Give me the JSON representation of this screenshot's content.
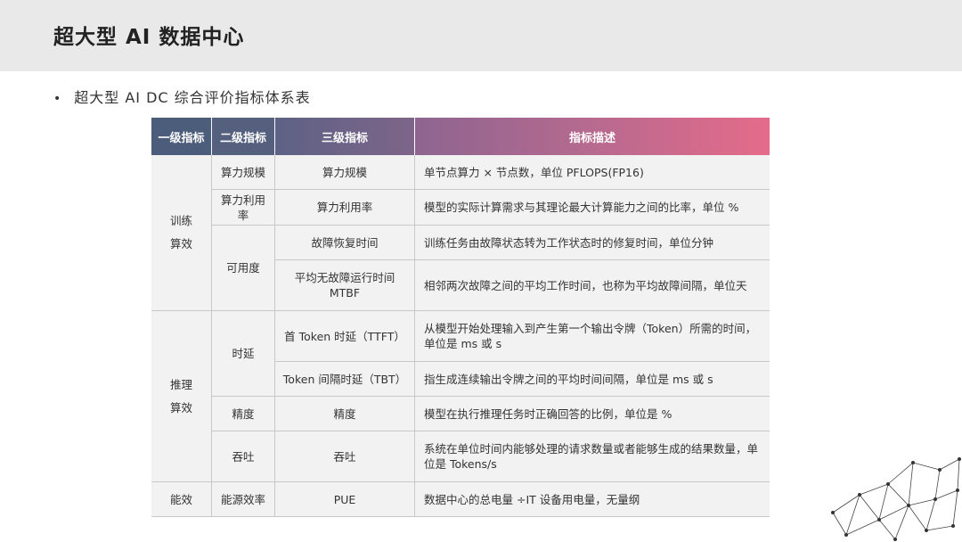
{
  "slide": {
    "title": "超大型 AI 数据中心",
    "bullet": "超大型 AI DC 综合评价指标体系表"
  },
  "table": {
    "headers": [
      "一级指标",
      "二级指标",
      "三级指标",
      "指标描述"
    ],
    "level1": [
      "训练\n算效",
      "推理\n算效",
      "能效"
    ],
    "level2": [
      "算力规模",
      "算力利用率",
      "可用度",
      "时延",
      "精度",
      "吞吐",
      "能源效率"
    ],
    "level3": [
      "算力规模",
      "算力利用率",
      "故障恢复时间",
      "平均无故障运行时间\nMTBF",
      "首 Token 时延（TTFT）",
      "Token 间隔时延（TBT）",
      "精度",
      "吞吐",
      "PUE"
    ],
    "descriptions": [
      "单节点算力 × 节点数，单位 PFLOPS(FP16)",
      "模型的实际计算需求与其理论最大计算能力之间的比率，单位 %",
      "训练任务由故障状态转为工作状态时的修复时间，单位分钟",
      "相邻两次故障之间的平均工作时间，也称为平均故障间隔，单位天",
      "从模型开始处理输入到产生第一个输出令牌（Token）所需的时间，单位是 ms 或 s",
      "指生成连续输出令牌之间的平均时间间隔，单位是 ms 或 s",
      "模型在执行推理任务时正确回答的比例，单位是 %",
      "系统在单位时间内能够处理的请求数量或者能够生成的结果数量，单位是 Tokens/s",
      "数据中心的总电量 ÷IT 设备用电量，无量纲"
    ]
  },
  "colors": {
    "header_start": "#4b5d7a",
    "header_end": "#e56b8a",
    "cell_bg": "#f2f2f2",
    "top_bar": "#e9e9e9"
  }
}
